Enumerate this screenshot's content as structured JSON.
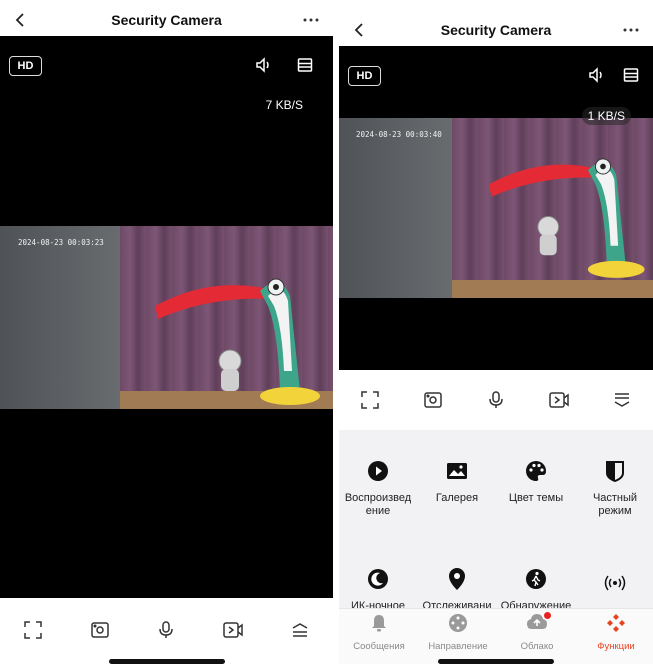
{
  "left": {
    "title": "Security Camera",
    "hd_label": "HD",
    "speed": "7 KB/S",
    "timestamp": "2024-08-23 00:03:23"
  },
  "right": {
    "title": "Security Camera",
    "hd_label": "HD",
    "speed": "1 KB/S",
    "timestamp": "2024-08-23 00:03:40",
    "functions": [
      {
        "label": "Воспроизвед ение",
        "icon": "play-icon"
      },
      {
        "label": "Галерея",
        "icon": "gallery-icon"
      },
      {
        "label": "Цвет темы",
        "icon": "palette-icon"
      },
      {
        "label": "Частный режим",
        "icon": "privacy-shield-icon"
      },
      {
        "label": "ИК-ночное",
        "icon": "moon-icon"
      },
      {
        "label": "Отслеживани",
        "icon": "location-pin-icon"
      },
      {
        "label": "Обнаружение",
        "icon": "motion-walker-icon"
      },
      {
        "label": "",
        "icon": "wireless-signal-icon"
      }
    ],
    "tabs": [
      {
        "label": "Сообщения",
        "icon": "bell-icon"
      },
      {
        "label": "Направление",
        "icon": "direction-pad-icon"
      },
      {
        "label": "Облако",
        "icon": "cloud-upload-icon"
      },
      {
        "label": "Функции",
        "icon": "functions-diamond-icon"
      }
    ],
    "active_tab": "Функции"
  },
  "colors": {
    "accent": "#e8431f",
    "video_bg": "#000000",
    "panel_bg": "#f2f2f4"
  }
}
